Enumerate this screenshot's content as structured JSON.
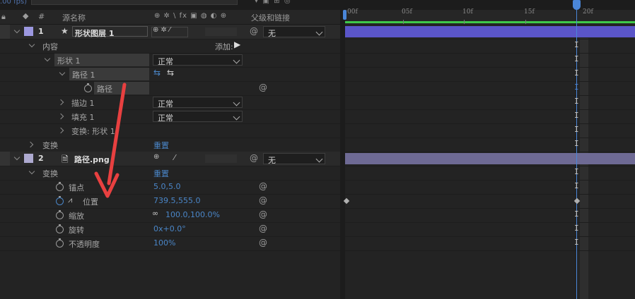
{
  "top": {
    "fps": ".00 fps)"
  },
  "header": {
    "source_name": "源名称",
    "parent_link": "父级和链接",
    "switch_icons": "⊕ ✲ \\ fx ▣ ◍ ◐ ⊕"
  },
  "ruler": {
    "t0": ":00f",
    "t5": "05f",
    "t10": "10f",
    "t15": "15f",
    "t20": "20f"
  },
  "layers": [
    {
      "num": "1",
      "name": "形状图层 1",
      "parent": "无"
    },
    {
      "num": "2",
      "name": "路径.png",
      "parent": "无"
    }
  ],
  "rows": {
    "contents": "内容",
    "add": "添加:",
    "shape1": "形状 1",
    "shape1_mode": "正常",
    "path1": "路径 1",
    "path": "路径",
    "stroke1": "描边 1",
    "stroke1_mode": "正常",
    "fill1": "填充 1",
    "fill1_mode": "正常",
    "transform_shape": "变换: 形状 1",
    "transform": "变换",
    "reset": "重置",
    "transform2": "变换",
    "reset2": "重置",
    "anchor": "锚点",
    "anchor_val": "5.0,5.0",
    "position": "位置",
    "position_val": "739.5,555.0",
    "scale": "缩放",
    "scale_val": "100.0,100.0%",
    "rotation": "旋转",
    "rotation_val": "0x+0.0°",
    "opacity": "不透明度",
    "opacity_val": "100%"
  },
  "colors": {
    "accent": "#4a86c8",
    "layer1_bar": "#5a55c8",
    "layer2_bar": "#6e6a94",
    "arrow": "#e84040"
  }
}
